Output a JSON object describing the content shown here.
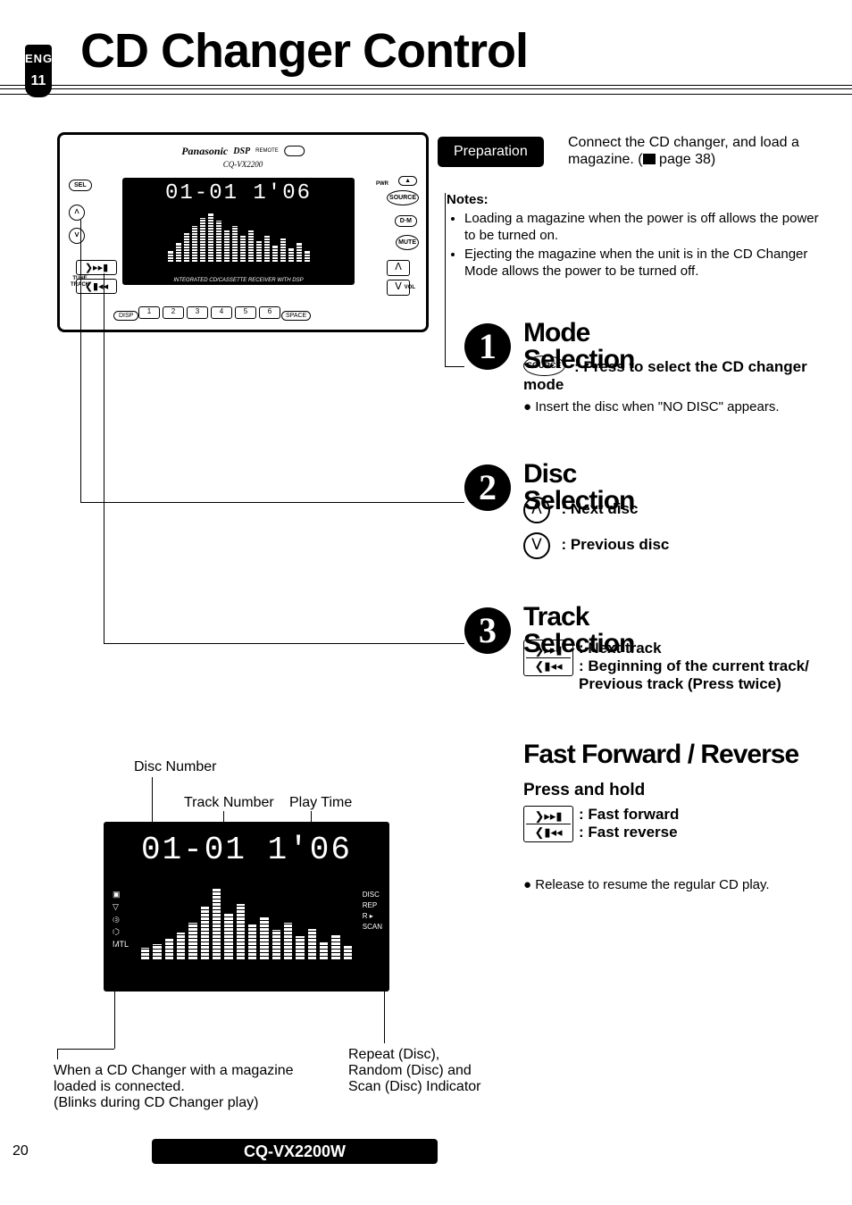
{
  "sidebar": {
    "language": "ENGLISH",
    "section": "11"
  },
  "title": "CD Changer Control",
  "device": {
    "brand": "Panasonic",
    "model": "CQ-VX2200",
    "dsp": "DSP",
    "sel": "SEL",
    "eject": "▲",
    "pwr": "PWR",
    "source": "SOURCE",
    "dm": "D·M",
    "mute": "MUTE",
    "tune": "TUNE\nTRACK",
    "vol": "VOL",
    "disp": "DISP",
    "space": "SPACE",
    "remote": "REMOTE",
    "display": "01-01  1'06",
    "band": "INTEGRATED CD/CASSETTE RECEIVER WITH DSP",
    "numbers": [
      "1",
      "2",
      "3",
      "4",
      "5",
      "6"
    ],
    "fwd": "❯▸▸▮",
    "rev": "❮▮◂◂",
    "up": "ᐱ",
    "down": "ᐯ"
  },
  "prep": {
    "label": "Preparation",
    "text_a": "Connect the CD changer, and load a magazine. (",
    "text_b": " page 38)"
  },
  "notes": {
    "heading": "Notes:",
    "n1": "Loading a magazine when the power is off allows the power to be turned on.",
    "n2": "Ejecting the magazine when the unit is in the CD Changer Mode allows the power to be turned off."
  },
  "steps": {
    "s1": {
      "n": "1",
      "h": "Mode Selection",
      "btn": "SOURCE",
      "inst": ": Press to select the CD changer mode",
      "line": "Insert the disc when \"NO DISC\" appears."
    },
    "s2": {
      "n": "2",
      "h": "Disc Selection",
      "next": ": Next disc",
      "prev": ": Previous disc",
      "up": "ᐱ",
      "down": "ᐯ"
    },
    "s3": {
      "n": "3",
      "h": "Track Selection",
      "next": ": Next track",
      "prev": ": Beginning of the current track/ Previous track (Press twice)",
      "fwd": "❯▸▸▮",
      "rev": "❮▮◂◂"
    }
  },
  "ff": {
    "h": "Fast Forward / Reverse",
    "sub": "Press and hold",
    "fwd": ": Fast forward",
    "rev": ": Fast reverse",
    "fwd_ic": "❯▸▸▮",
    "rev_ic": "❮▮◂◂",
    "note": "Release to resume the regular CD play."
  },
  "callouts": {
    "disc": "Disc Number",
    "track": "Track Number",
    "play": "Play Time",
    "left": "When a CD Changer with a magazine loaded is connected.\n(Blinks during CD Changer play)",
    "right": "Repeat (Disc),\nRandom (Disc) and\nScan (Disc) Indicator"
  },
  "disp2": {
    "digits": "01-01  1'06",
    "ind": "DISC\nREP\nR ▸\nSCAN",
    "left": "▣\n▽\n◎\n⬡\nMTL"
  },
  "pageNum": "20",
  "modelBar": "CQ-VX2200W"
}
